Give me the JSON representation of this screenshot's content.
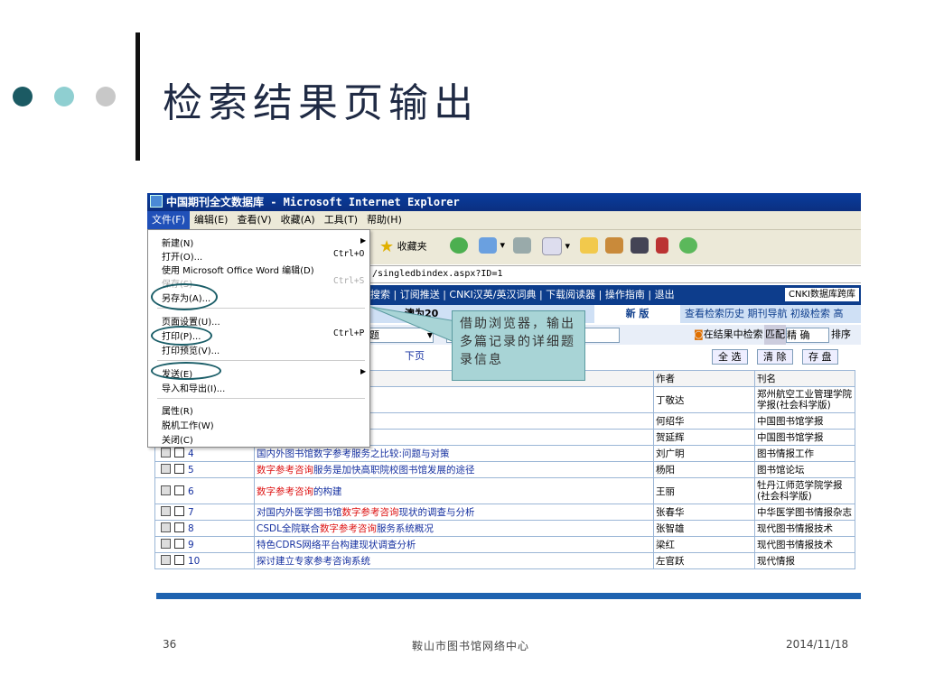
{
  "slide": {
    "title": "检索结果页输出",
    "page_number": "36",
    "footer_center": "鞍山市图书馆网络中心",
    "date": "2014/11/18",
    "callout_text": "借助浏览器，输出多篇记录的详细题录信息",
    "dot_colors": [
      "#1b5a63",
      "#8fcfd1",
      "#c8c8c8"
    ]
  },
  "window": {
    "title": "中国期刊全文数据库 - Microsoft Internet Explorer",
    "menus": [
      "文件(F)",
      "编辑(E)",
      "查看(V)",
      "收藏(A)",
      "工具(T)",
      "帮助(H)"
    ],
    "favorites_label": "收藏夹",
    "address": "/singledbindex.aspx?ID=1"
  },
  "file_menu": {
    "items": [
      {
        "label": "新建(N)",
        "shortcut": ""
      },
      {
        "label": "打开(O)...",
        "shortcut": "Ctrl+O"
      },
      {
        "label": "使用 Microsoft Office Word 编辑(D)",
        "shortcut": ""
      },
      {
        "label": "保存(S)",
        "shortcut": "Ctrl+S"
      },
      {
        "label": "另存为(A)...",
        "shortcut": ""
      },
      {
        "label": "页面设置(U)...",
        "shortcut": ""
      },
      {
        "label": "打印(P)...",
        "shortcut": "Ctrl+P"
      },
      {
        "label": "打印预览(V)...",
        "shortcut": ""
      },
      {
        "label": "发送(E)",
        "shortcut": ""
      },
      {
        "label": "导入和导出(I)...",
        "shortcut": ""
      },
      {
        "label": "属性(R)",
        "shortcut": ""
      },
      {
        "label": "脱机工作(W)",
        "shortcut": ""
      },
      {
        "label": "关闭(C)",
        "shortcut": ""
      }
    ]
  },
  "site": {
    "nav": "搜索 | 订阅推送 | CNKI汉英/英汉词典 | 下载阅读器 | 操作指南 | 退出",
    "nav_button": "CNKI数据库跨库",
    "subnav_left": "澳为20",
    "subnav_tab": "新 版",
    "subnav_links": "查看检索历史  期刊导航  初级检索  高",
    "filter_field": "题",
    "search_in_results": "在结果中检索",
    "match_label": "匹配",
    "match_value": "精 确",
    "sort_label": "排序",
    "next_page": "下页",
    "select_all": "全 选",
    "clear": "清 除",
    "save": "存 盘"
  },
  "table": {
    "headers": [
      "",
      "",
      "作者",
      "刊名"
    ],
    "rows": [
      {
        "no": "1",
        "title_hl": "",
        "title": "标体系",
        "author": "丁敬达",
        "journal": "郑州航空工业管理学院学报(社会科学版)"
      },
      {
        "no": "2",
        "title_hl": "",
        "title": "务业中的定位研究",
        "author": "何绍华",
        "journal": "中国图书馆学报"
      },
      {
        "no": "3",
        "title_hl": "",
        "title": "趋势",
        "author": "贺延辉",
        "journal": "中国图书馆学报"
      },
      {
        "no": "4",
        "title_hl": "",
        "title": "国内外图书馆数字参考服务之比较:问题与对策",
        "author": "刘广明",
        "journal": "图书情报工作"
      },
      {
        "no": "5",
        "title_hl": "数字参考咨询",
        "title": "服务是加快高职院校图书馆发展的途径",
        "author": "杨阳",
        "journal": "图书馆论坛"
      },
      {
        "no": "6",
        "title_hl": "数字参考咨询",
        "title": "的构建",
        "author": "王丽",
        "journal": "牡丹江师范学院学报(社会科学版)"
      },
      {
        "no": "7",
        "title_pre": "对国内外医学图书馆",
        "title_hl": "数字参考咨询",
        "title": "现状的调查与分析",
        "author": "张春华",
        "journal": "中华医学图书情报杂志"
      },
      {
        "no": "8",
        "title_pre": "CSDL全院联合",
        "title_hl": "数字参考咨询",
        "title": "服务系统概况",
        "author": "张智雄",
        "journal": "现代图书情报技术"
      },
      {
        "no": "9",
        "title_hl": "",
        "title": "特色CDRS网络平台构建现状调查分析",
        "author": "梁红",
        "journal": "现代图书情报技术"
      },
      {
        "no": "10",
        "title_hl": "",
        "title": "探讨建立专家参考咨询系统",
        "author": "左官跃",
        "journal": "现代情报"
      }
    ]
  }
}
